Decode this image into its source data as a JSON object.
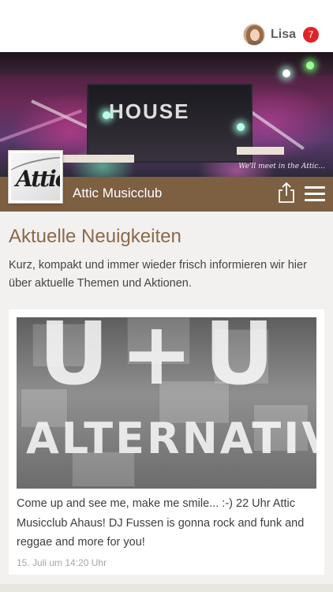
{
  "header": {
    "user": {
      "name": "Lisa",
      "notification_count": "7"
    }
  },
  "hero": {
    "stage_sign": "HOUSE",
    "slogan": "We'll meet in the Attic..."
  },
  "brand": {
    "name": "Attic Musicclub",
    "logo_text": "Attic",
    "share_icon": "share-icon",
    "menu_icon": "hamburger-menu-icon",
    "bar_color": "#7d5f42"
  },
  "news": {
    "title": "Aktuelle Neuigkeiten",
    "intro": "Kurz, kompakt und immer wieder frisch informieren wir hier über aktuelle Themen und Aktionen.",
    "items": [
      {
        "image_headline": "U+U",
        "image_subline": "ALTERNATIV",
        "text": "Come up and see me, make me smile... :-) 22 Uhr Attic Musicclub Ahaus! DJ Fussen is gonna rock and funk and reggae and more for you!",
        "date": "15. Juli um 14:20 Uhr"
      }
    ]
  },
  "colors": {
    "accent_title": "#8a6a4c",
    "badge": "#e0232b",
    "page_bg": "#f3f1ef"
  }
}
